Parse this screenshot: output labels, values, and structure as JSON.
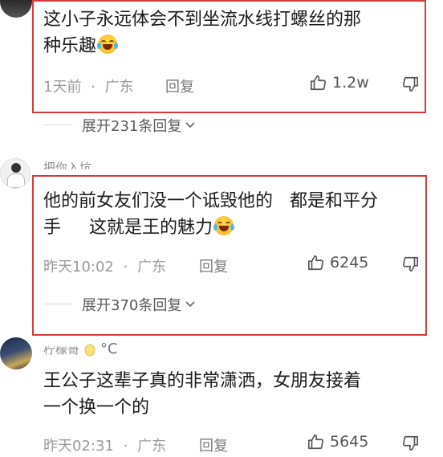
{
  "comments": [
    {
      "text_line1": "这小子永远体会不到坐流水线打螺丝的那",
      "text_line2": "种乐趣",
      "emoji": "laughing-tears-emoji",
      "time": "1天前",
      "location": "广东",
      "reply_label": "回复",
      "likes": "1.2w",
      "expand_label": "展开231条回复"
    },
    {
      "username": "把你入坑",
      "text_line1": "他的前女友们没一个诋毁他的   都是和平分",
      "text_line2": "手     这就是王的魅力",
      "emoji": "laughing-tears-emoji",
      "time": "昨天10:02",
      "location": "广东",
      "reply_label": "回复",
      "likes": "6245",
      "expand_label": "展开370条回复"
    },
    {
      "username": "柠檬哥",
      "username_suffix": "°C",
      "text_line1": "王公子这辈子真的非常潇洒，女朋友接着",
      "text_line2": "一个换一个的",
      "time": "昨天02:31",
      "location": "广东",
      "reply_label": "回复",
      "likes": "5645"
    }
  ],
  "separator": "·",
  "colors": {
    "highlight_border": "#d93a3a",
    "meta_gray": "#9a9a9a"
  },
  "icons": [
    "thumbs-up-icon",
    "thumbs-down-icon",
    "chevron-down-icon"
  ]
}
